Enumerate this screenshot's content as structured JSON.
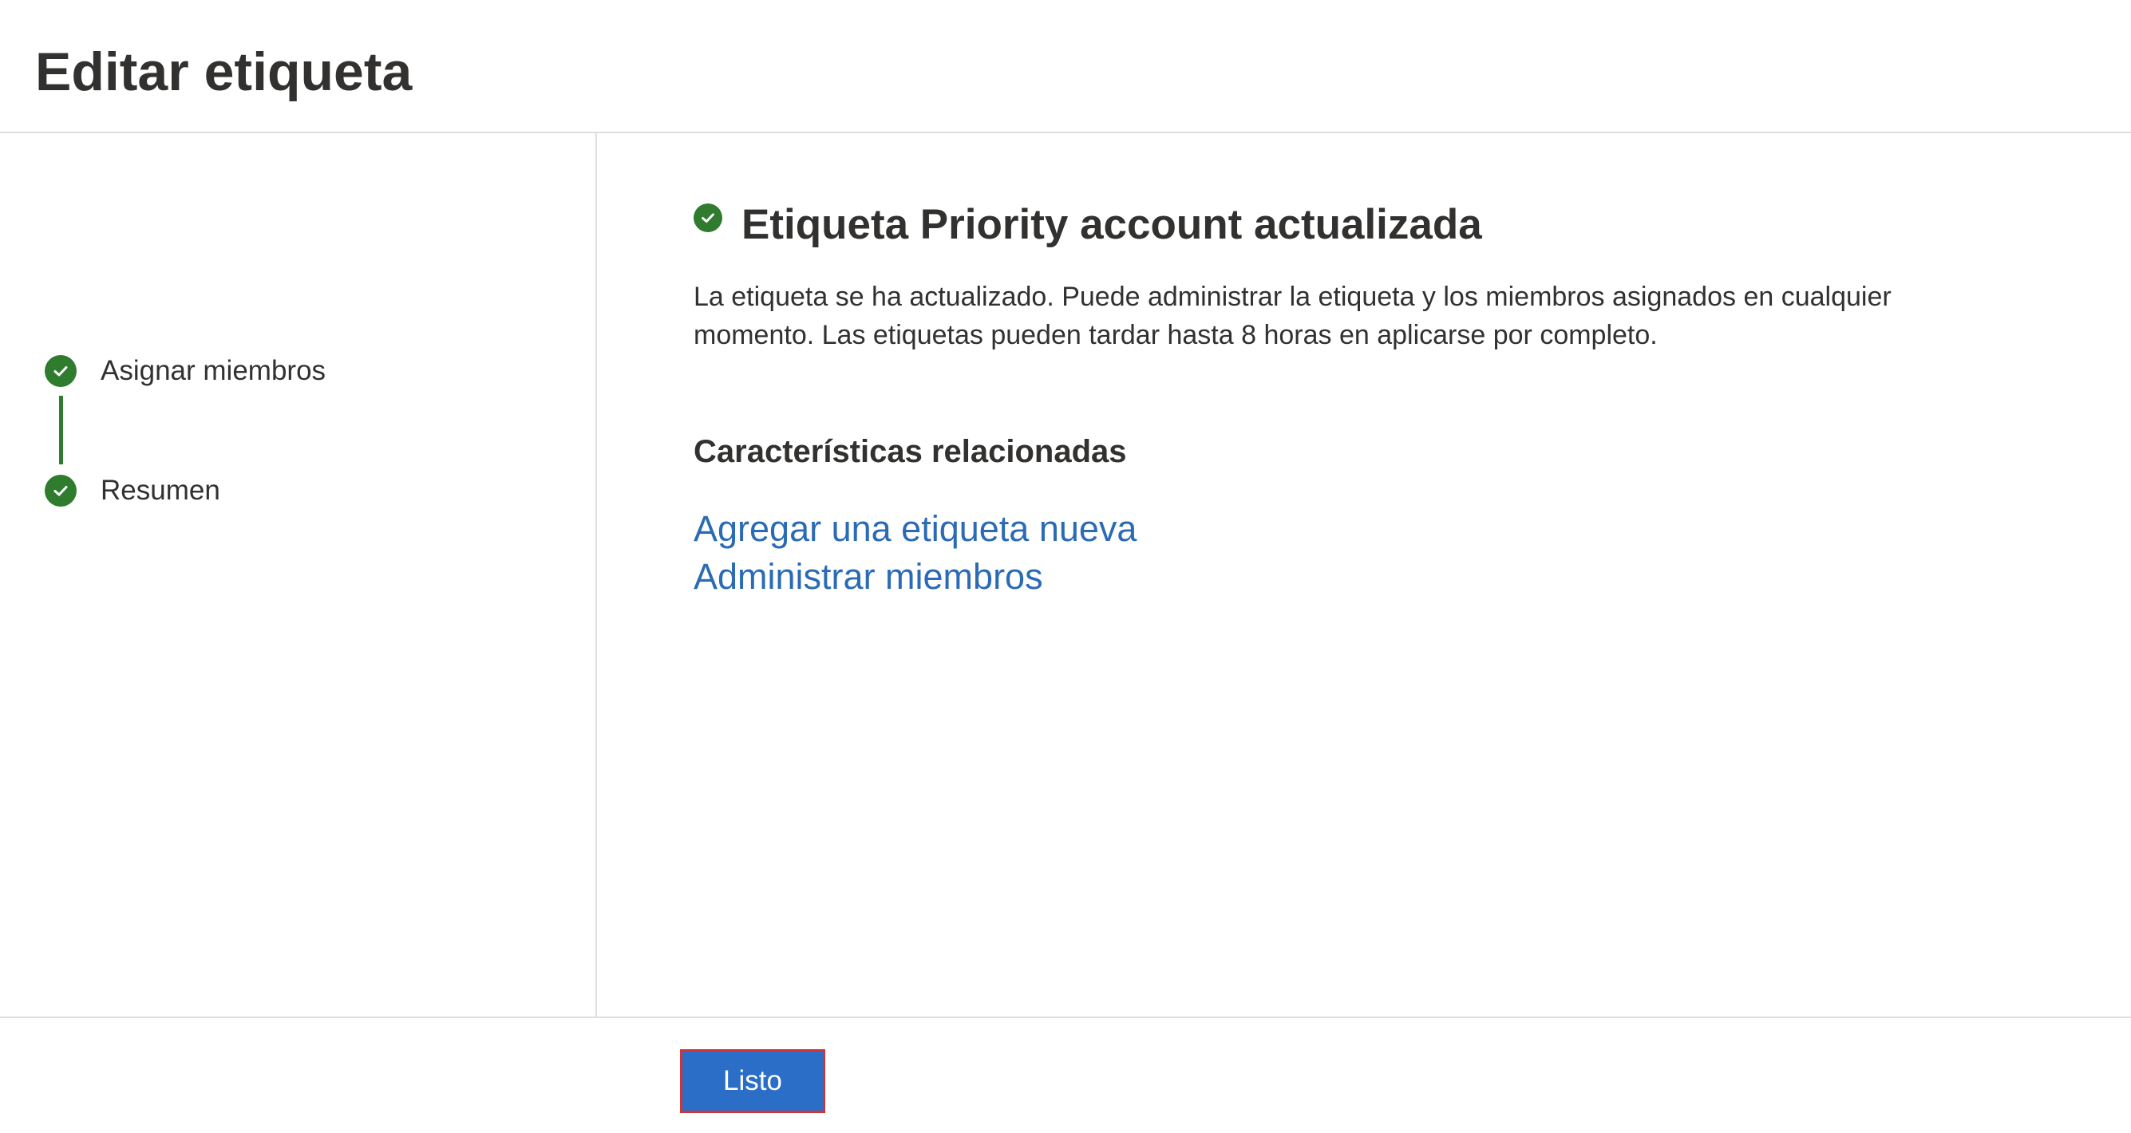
{
  "page": {
    "title": "Editar etiqueta"
  },
  "steps": [
    {
      "label": "Asignar miembros",
      "icon": "checkmark-icon",
      "status": "completed"
    },
    {
      "label": "Resumen",
      "icon": "checkmark-icon",
      "status": "completed"
    }
  ],
  "main": {
    "success_title": "Etiqueta Priority account actualizada",
    "success_icon": "checkmark-circle-icon",
    "description": "La etiqueta se ha actualizado. Puede administrar la etiqueta y los miembros asignados en cualquier momento. Las etiquetas pueden tardar hasta 8 horas en aplicarse por completo.",
    "related_heading": "Características relacionadas",
    "links": [
      {
        "label": "Agregar una etiqueta nueva"
      },
      {
        "label": "Administrar miembros"
      }
    ]
  },
  "footer": {
    "done_label": "Listo"
  },
  "colors": {
    "success_green": "#2f7c2f",
    "link_blue": "#2b6bb5",
    "primary_button": "#2b6ec7",
    "highlight_border": "#d13438"
  }
}
